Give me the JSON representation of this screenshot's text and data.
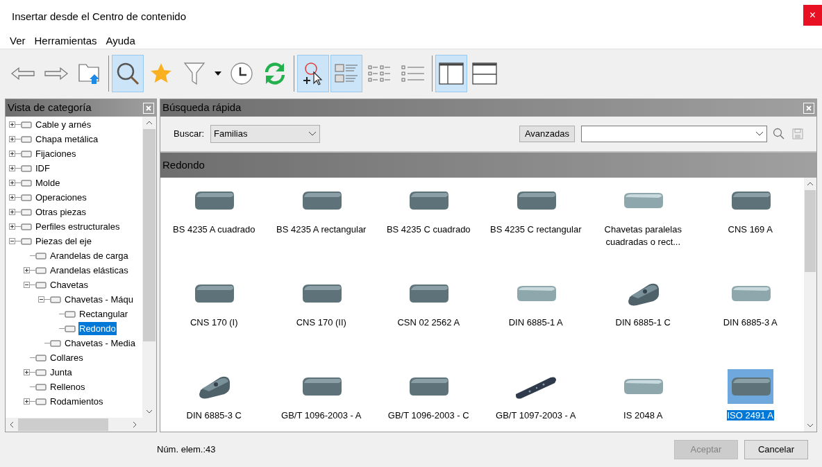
{
  "window": {
    "title": "Insertar desde el Centro de contenido",
    "close": "×"
  },
  "menu": [
    "Ver",
    "Herramientas",
    "Ayuda"
  ],
  "toolbar": [
    {
      "kind": "back",
      "selected": false
    },
    {
      "kind": "forward",
      "selected": false
    },
    {
      "kind": "folder-up",
      "selected": false
    },
    {
      "kind": "separator"
    },
    {
      "kind": "search",
      "selected": true
    },
    {
      "kind": "star",
      "selected": false
    },
    {
      "kind": "filter",
      "selected": false
    },
    {
      "kind": "caret",
      "selected": false
    },
    {
      "kind": "clock",
      "selected": false
    },
    {
      "kind": "refresh",
      "selected": false
    },
    {
      "kind": "separator"
    },
    {
      "kind": "pick",
      "selected": true
    },
    {
      "kind": "details",
      "selected": true
    },
    {
      "kind": "small-icons",
      "selected": false
    },
    {
      "kind": "list",
      "selected": false
    },
    {
      "kind": "separator"
    },
    {
      "kind": "split-vertical",
      "selected": true
    },
    {
      "kind": "split-horizontal",
      "selected": false
    }
  ],
  "category_panel": {
    "title": "Vista de categoría",
    "tree": [
      {
        "label": "Cable y arnés",
        "expanded": false,
        "selected": false
      },
      {
        "label": "Chapa metálica",
        "expanded": false,
        "selected": false
      },
      {
        "label": "Fijaciones",
        "expanded": false,
        "selected": false
      },
      {
        "label": "IDF",
        "expanded": false,
        "selected": false
      },
      {
        "label": "Molde",
        "expanded": false,
        "selected": false
      },
      {
        "label": "Operaciones",
        "expanded": false,
        "selected": false
      },
      {
        "label": "Otras piezas",
        "expanded": false,
        "selected": false
      },
      {
        "label": "Perfiles estructurales",
        "expanded": false,
        "selected": false
      },
      {
        "label": "Piezas del eje",
        "expanded": true,
        "selected": false,
        "children": [
          {
            "label": "Arandelas de carga",
            "selected": false
          },
          {
            "label": "Arandelas elásticas",
            "expanded": false,
            "selected": false
          },
          {
            "label": "Chavetas",
            "expanded": true,
            "selected": false,
            "children": [
              {
                "label": "Chavetas - Máqu",
                "expanded": true,
                "selected": false,
                "children": [
                  {
                    "label": "Rectangular",
                    "selected": false
                  },
                  {
                    "label": "Redondo",
                    "selected": true
                  }
                ]
              },
              {
                "label": "Chavetas - Media",
                "selected": false
              }
            ]
          },
          {
            "label": "Collares",
            "selected": false
          },
          {
            "label": "Junta",
            "expanded": false,
            "selected": false
          },
          {
            "label": "Rellenos",
            "selected": false
          },
          {
            "label": "Rodamientos",
            "expanded": false,
            "selected": false
          }
        ]
      }
    ]
  },
  "quick_search": {
    "title": "Búsqueda rápida",
    "search_label": "Buscar:",
    "search_in": "Familias",
    "advanced_button": "Avanzadas"
  },
  "results": {
    "title": "Redondo",
    "items": [
      {
        "label": "BS 4235 A cuadrado",
        "kind": "key",
        "selected": false
      },
      {
        "label": "BS 4235 A rectangular",
        "kind": "key",
        "selected": false
      },
      {
        "label": "BS 4235 C cuadrado",
        "kind": "key",
        "selected": false
      },
      {
        "label": "BS 4235 C rectangular",
        "kind": "key",
        "selected": false
      },
      {
        "label": "Chavetas paralelas cuadradas o rect...",
        "kind": "light",
        "selected": false
      },
      {
        "label": "CNS 169 A",
        "kind": "key",
        "selected": false
      },
      {
        "label": "CNS 170 (I)",
        "kind": "key",
        "selected": false
      },
      {
        "label": "CNS 170 (II)",
        "kind": "key",
        "selected": false
      },
      {
        "label": "CSN 02 2562 A",
        "kind": "key",
        "selected": false
      },
      {
        "label": "DIN 6885-1 A",
        "kind": "light",
        "selected": false
      },
      {
        "label": "DIN 6885-1 C",
        "kind": "holed",
        "selected": false
      },
      {
        "label": "DIN 6885-3 A",
        "kind": "light",
        "selected": false
      },
      {
        "label": "DIN 6885-3 C",
        "kind": "holed",
        "selected": false
      },
      {
        "label": "GB/T 1096-2003 - A",
        "kind": "key",
        "selected": false
      },
      {
        "label": "GB/T 1096-2003 - C",
        "kind": "key",
        "selected": false
      },
      {
        "label": "GB/T 1097-2003 - A",
        "kind": "strip",
        "selected": false
      },
      {
        "label": "IS 2048 A",
        "kind": "light",
        "selected": false
      },
      {
        "label": "ISO 2491 A",
        "kind": "key",
        "selected": true
      }
    ]
  },
  "footer": {
    "count": "Núm. elem.:43",
    "buttons": [
      {
        "label": "Aceptar",
        "disabled": true
      },
      {
        "label": "Cancelar",
        "disabled": false
      }
    ]
  }
}
